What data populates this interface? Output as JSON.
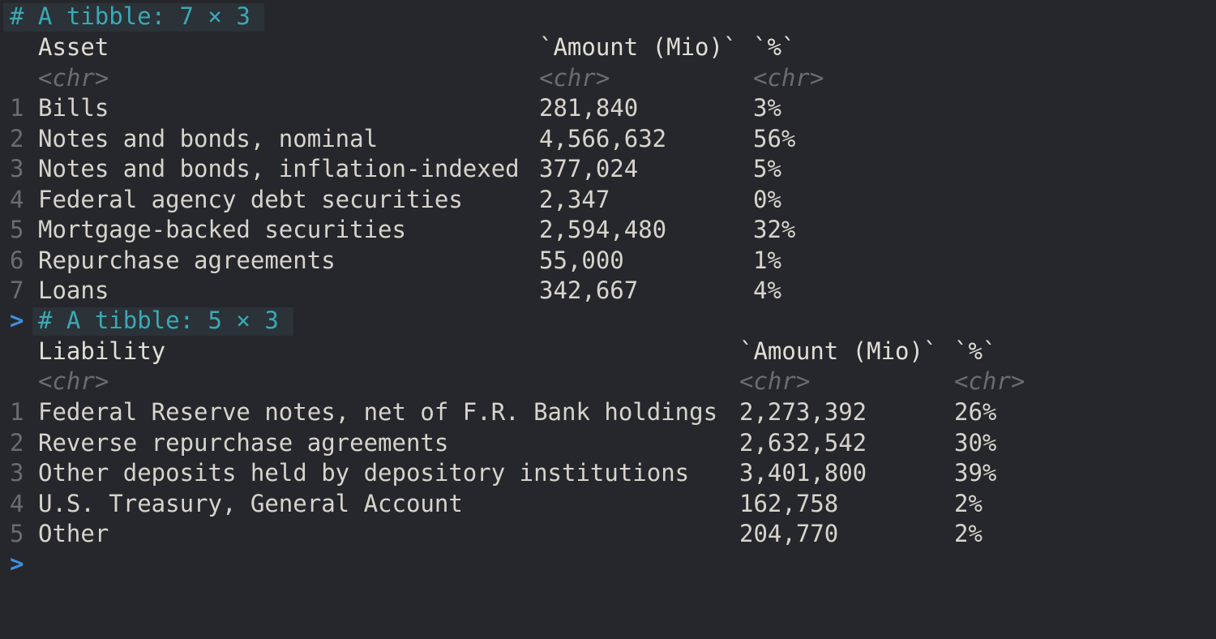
{
  "console": {
    "prompt_symbol": ">",
    "tables": [
      {
        "meta": "# A tibble: 7 × 3",
        "has_prompt": false,
        "columns": [
          "Asset",
          "`Amount (Mio)`",
          "`%`"
        ],
        "types": [
          "<chr>",
          "<chr>",
          "<chr>"
        ],
        "rows": [
          {
            "n": "1",
            "label": "Bills",
            "amount": "281,840",
            "pct": "3%"
          },
          {
            "n": "2",
            "label": "Notes and bonds, nominal",
            "amount": "4,566,632",
            "pct": "56%"
          },
          {
            "n": "3",
            "label": "Notes and bonds, inflation-indexed",
            "amount": "377,024",
            "pct": "5%"
          },
          {
            "n": "4",
            "label": "Federal agency debt securities",
            "amount": "2,347",
            "pct": "0%"
          },
          {
            "n": "5",
            "label": "Mortgage-backed securities",
            "amount": "2,594,480",
            "pct": "32%"
          },
          {
            "n": "6",
            "label": "Repurchase agreements",
            "amount": "55,000",
            "pct": "1%"
          },
          {
            "n": "7",
            "label": "Loans",
            "amount": "342,667",
            "pct": "4%"
          }
        ]
      },
      {
        "meta": "# A tibble: 5 × 3",
        "has_prompt": true,
        "columns": [
          "Liability",
          "`Amount (Mio)`",
          "`%`"
        ],
        "types": [
          "<chr>",
          "<chr>",
          "<chr>"
        ],
        "rows": [
          {
            "n": "1",
            "label": "Federal Reserve notes, net of F.R. Bank holdings",
            "amount": "2,273,392",
            "pct": "26%"
          },
          {
            "n": "2",
            "label": "Reverse repurchase agreements",
            "amount": "2,632,542",
            "pct": "30%"
          },
          {
            "n": "3",
            "label": "Other deposits held by depository institutions",
            "amount": "3,401,800",
            "pct": "39%"
          },
          {
            "n": "4",
            "label": "U.S. Treasury, General Account",
            "amount": "162,758",
            "pct": "2%"
          },
          {
            "n": "5",
            "label": "Other",
            "amount": "204,770",
            "pct": "2%"
          }
        ]
      }
    ]
  },
  "colors": {
    "background": "#25272c",
    "meta_text": "#3aa9b5",
    "meta_highlight": "#2b3238",
    "prompt": "#3f8fe0",
    "type_hint": "#6a6c70",
    "text": "#d8d4cc"
  }
}
